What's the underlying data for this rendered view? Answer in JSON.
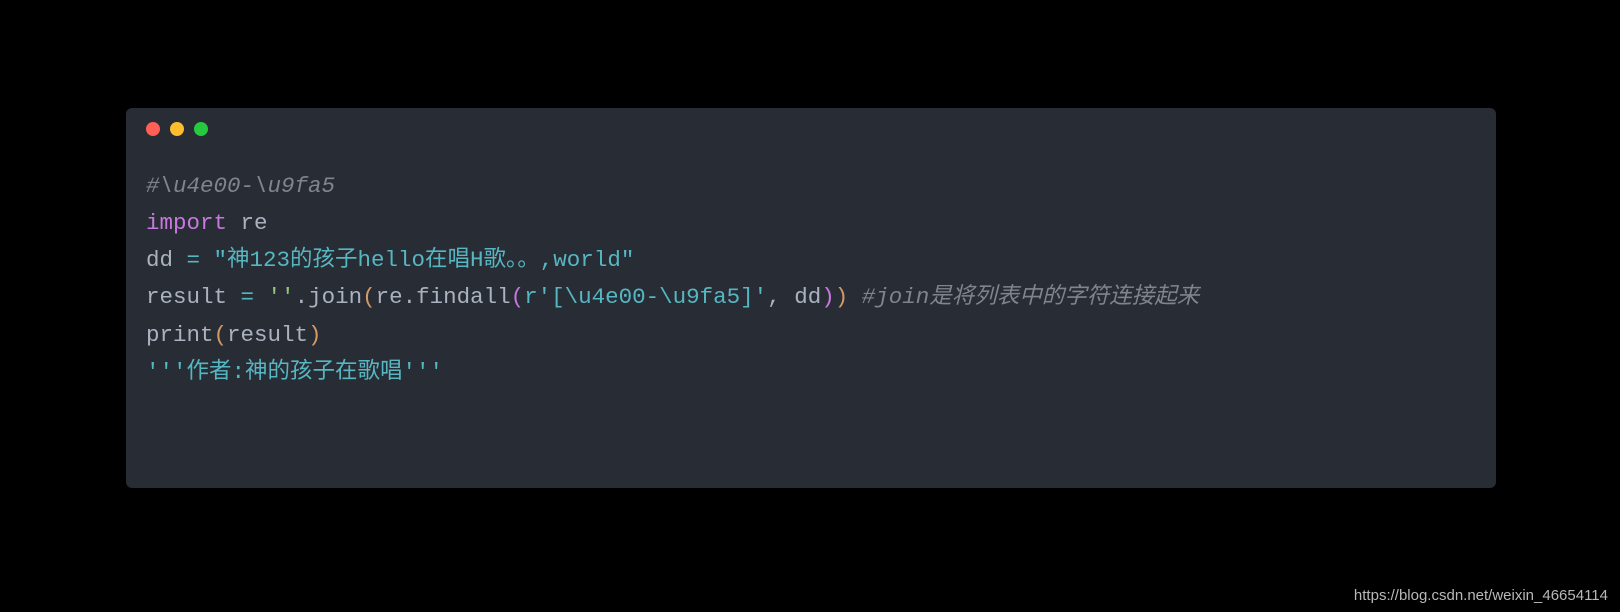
{
  "code": {
    "line1_comment": "#\\u4e00-\\u9fa5",
    "line2_import": "import",
    "line2_module": " re",
    "line3_var": "dd ",
    "line3_eq": "=",
    "line3_str": " \"神123的孩子hello在唱H歌。。,world\"",
    "line4_var": "result ",
    "line4_eq": "=",
    "line4_space1": " ",
    "line4_emptystr": "''",
    "line4_join": ".join",
    "line4_p1o": "(",
    "line4_findall": "re.findall",
    "line4_p2o": "(",
    "line4_rstr": "r'[\\u4e00-\\u9fa5]'",
    "line4_comma": ", dd",
    "line4_p2c": ")",
    "line4_p1c": ")",
    "line4_space2": " ",
    "line4_comment": "#join是将列表中的字符连接起来",
    "line5_print": "print",
    "line5_po": "(",
    "line5_arg": "result",
    "line5_pc": ")",
    "line6_docstr": "'''作者:神的孩子在歌唱'''"
  },
  "watermark": "https://blog.csdn.net/weixin_46654114"
}
